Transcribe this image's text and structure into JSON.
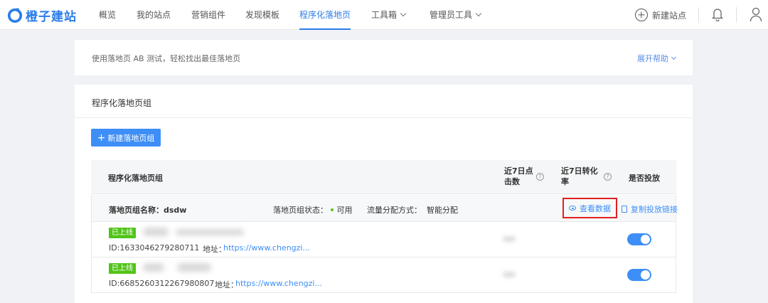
{
  "brand": {
    "name": "橙子建站"
  },
  "nav": {
    "items": [
      {
        "label": "概览"
      },
      {
        "label": "我的站点"
      },
      {
        "label": "营销组件"
      },
      {
        "label": "发现模板"
      },
      {
        "label": "程序化落地页",
        "active": true
      },
      {
        "label": "工具箱",
        "dropdown": true
      },
      {
        "label": "管理员工具",
        "dropdown": true
      }
    ],
    "new_site_label": "新建站点"
  },
  "help": {
    "text": "使用落地页 AB 测试，轻松找出最佳落地页",
    "toggle_label": "展开帮助"
  },
  "main": {
    "title": "程序化落地页组",
    "new_group_label": "新建落地页组",
    "table": {
      "headers": {
        "name": "程序化落地页组",
        "clicks_line1": "近7日点",
        "clicks_line2": "击数",
        "cvr_line1": "近7日转化",
        "cvr_line2": "率",
        "status": "是否投放"
      },
      "help_glyph": "?",
      "group": {
        "name_label": "落地页组名称：",
        "name_value": "dsdw",
        "status_label": "落地页组状态：",
        "status_value": "可用",
        "traffic_label": "流量分配方式：",
        "traffic_value": "智能分配",
        "view_data_label": "查看数据",
        "copy_link_label": "复制投放链接"
      },
      "rows": [
        {
          "badge": "已上线",
          "id": "ID:1633046279280711",
          "addr_label": "地址：",
          "addr": "https://www.chengzi...",
          "enabled": true
        },
        {
          "badge": "已上线",
          "id": "ID:6685260312267980807",
          "addr_label": "地址：",
          "addr": "https://www.chengzi...",
          "enabled": true
        }
      ]
    }
  },
  "colors": {
    "accent": "#3e8ef7",
    "online": "#52c41a",
    "highlight": "#e02020"
  }
}
